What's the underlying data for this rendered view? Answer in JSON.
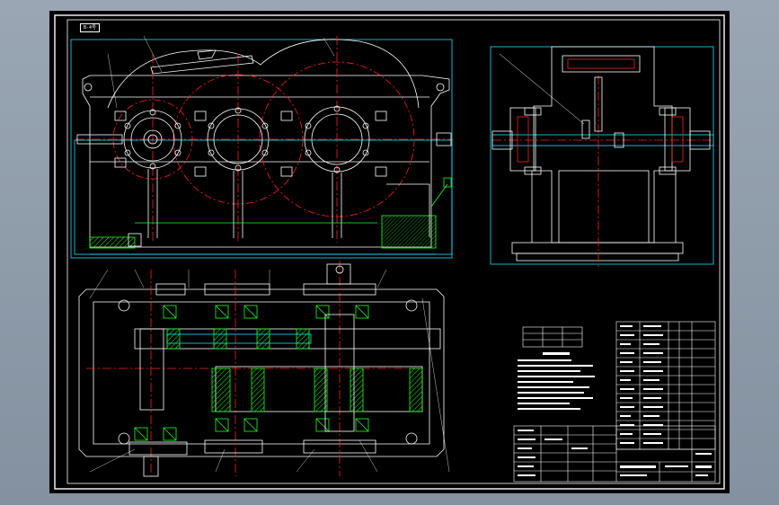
{
  "drawing": {
    "title_stamp": "B-4号",
    "colors": {
      "background": "#000000",
      "outline": "#ffffff",
      "centerline": "#ff2020",
      "assembly": "#20e0ff",
      "hatch": "#20ff20",
      "leader": "#ffffff",
      "border": "#ffffff"
    },
    "views": [
      "front-view",
      "side-view",
      "top-section-view",
      "title-block",
      "technical-notes",
      "parts-list"
    ]
  }
}
